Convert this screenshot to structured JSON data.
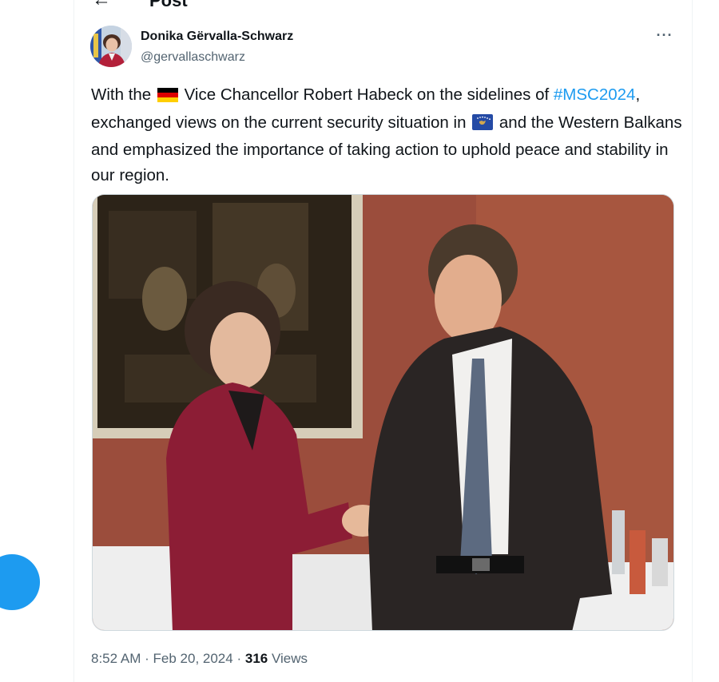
{
  "header": {
    "back_icon": "arrow-left-icon",
    "title": "Post"
  },
  "tweet": {
    "author_name": "Donika Gërvalla-Schwarz",
    "author_handle": "@gervallaschwarz",
    "more_icon": "more-horizontal-icon",
    "more_label": "···",
    "text": {
      "part1": "With the",
      "part2": "Vice Chancellor Robert Habeck on the sidelines of",
      "hashtag": "#MSC2024",
      "part3": ", exchanged views on the current security situation in",
      "part4": "and the Western Balkans and emphasized the importance of taking action to uphold peace and stability in our region."
    },
    "flags": {
      "germany": {
        "icon": "germany-flag-icon",
        "colors": [
          "#000000",
          "#dd0000",
          "#ffce00"
        ]
      },
      "kosovo": {
        "icon": "kosovo-flag-icon",
        "colors": [
          "#244aa5",
          "#d0a650",
          "#ffffff"
        ]
      }
    },
    "time": "8:52 AM",
    "separator": "·",
    "date": "Feb 20, 2024",
    "views_count": "316",
    "views_label": "Views"
  },
  "colors": {
    "accent": "#1d9bf0",
    "text_primary": "#0f1419",
    "text_secondary": "#536471",
    "border": "#eff3f4"
  }
}
